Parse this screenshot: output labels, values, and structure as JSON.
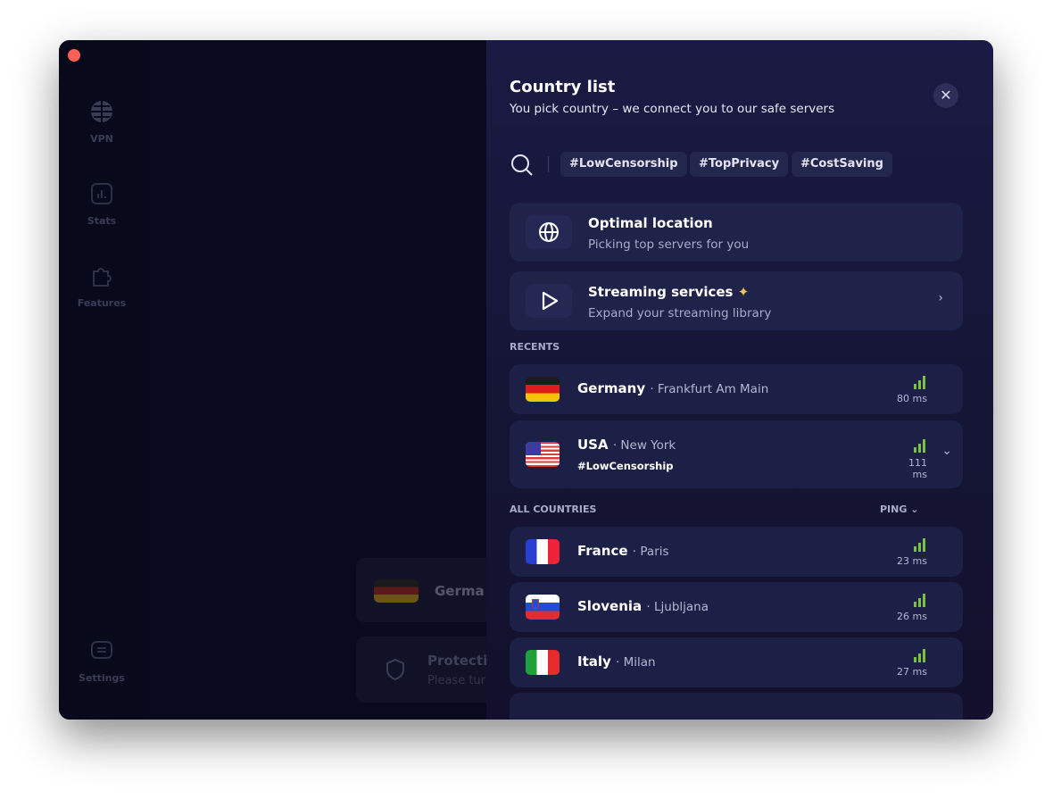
{
  "sidebar": {
    "items": [
      {
        "label": "VPN",
        "icon": "globe-icon"
      },
      {
        "label": "Stats",
        "icon": "chart-icon"
      },
      {
        "label": "Features",
        "icon": "puzzle-icon"
      },
      {
        "label": "Settings",
        "icon": "settings-icon"
      }
    ]
  },
  "background": {
    "location": "Germa",
    "protection_title": "Protecti",
    "protection_sub": "Please tur"
  },
  "panel": {
    "title": "Country list",
    "subtitle": "You pick country – we connect you to our safe servers",
    "tags": [
      "#LowCensorship",
      "#TopPrivacy",
      "#CostSaving"
    ],
    "optimal": {
      "title": "Optimal location",
      "subtitle": "Picking top servers for you"
    },
    "streaming": {
      "title": "Streaming services",
      "subtitle": "Expand your streaming library"
    },
    "recents_label": "RECENTS",
    "recents": [
      {
        "country": "Germany",
        "city": "Frankfurt Am Main",
        "ping": "80 ms",
        "flag": "de"
      },
      {
        "country": "USA",
        "city": "New York",
        "tag": "#LowCensorship",
        "ping": "111 ms",
        "flag": "us"
      }
    ],
    "all_label": "ALL COUNTRIES",
    "sort_label": "PING",
    "countries": [
      {
        "country": "France",
        "city": "Paris",
        "ping": "23 ms",
        "flag": "fr"
      },
      {
        "country": "Slovenia",
        "city": "Ljubljana",
        "ping": "26 ms",
        "flag": "si"
      },
      {
        "country": "Italy",
        "city": "Milan",
        "ping": "27 ms",
        "flag": "it"
      }
    ]
  },
  "colors": {
    "accent_signal": "#7ac143",
    "background": "#0a0a1f",
    "panel": "#1a1a44"
  }
}
